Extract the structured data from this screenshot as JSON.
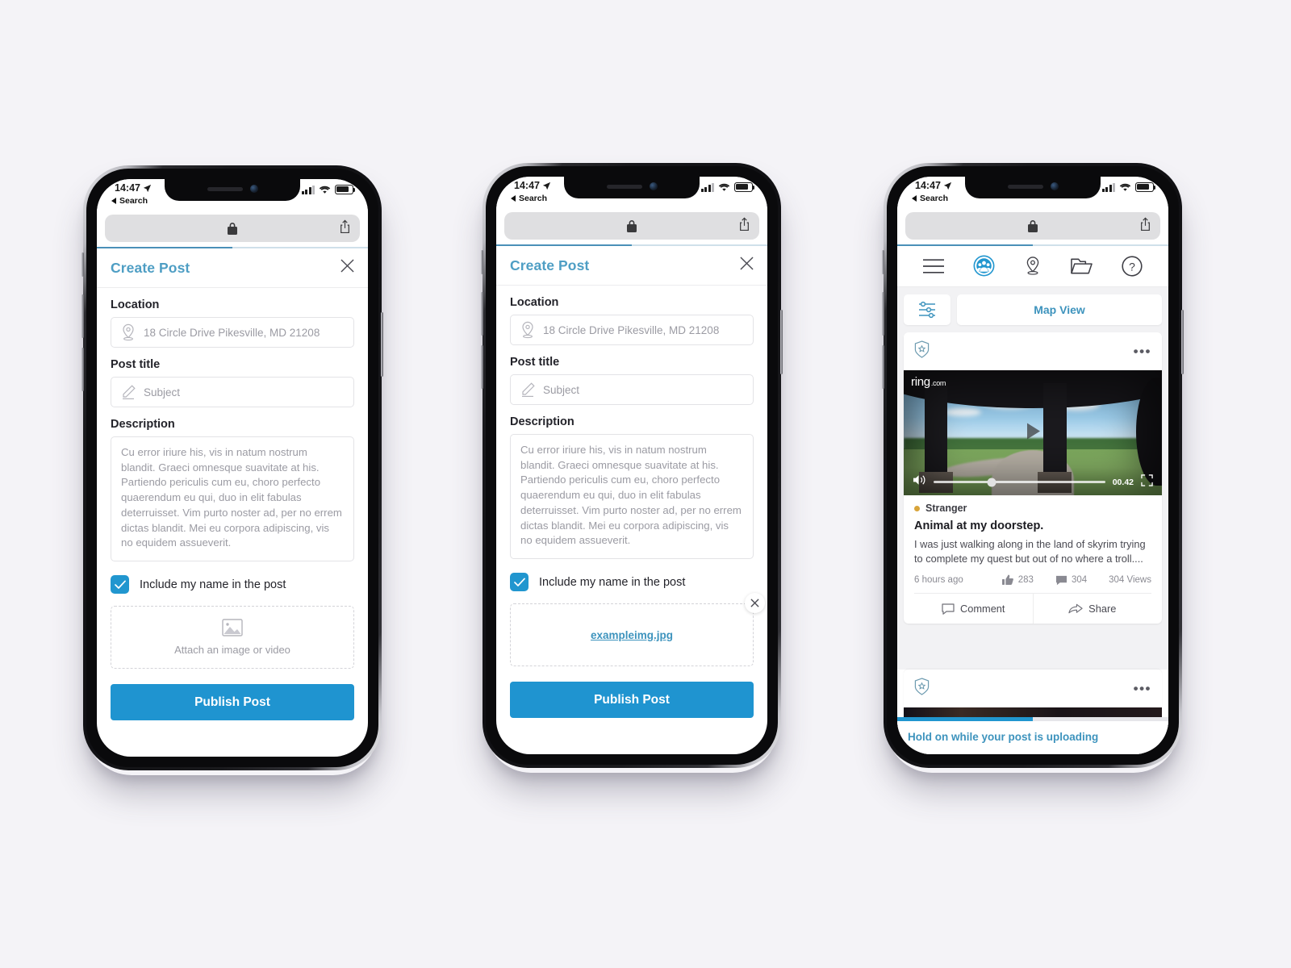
{
  "status_bar": {
    "time": "14:47",
    "back_label": "Search",
    "location_arrow_icon": "location-arrow-icon",
    "signal_icon": "cellular-signal-icon",
    "wifi_icon": "wifi-icon",
    "battery_icon": "battery-icon"
  },
  "browser": {
    "lock_icon": "lock-icon",
    "share_icon": "share-icon",
    "progress_percent": 50
  },
  "create_post": {
    "title": "Create Post",
    "close_icon": "close-icon",
    "location": {
      "label": "Location",
      "icon": "map-pin-icon",
      "value": "18 Circle Drive Pikesville, MD 21208"
    },
    "post_title": {
      "label": "Post title",
      "icon": "pencil-icon",
      "placeholder": "Subject"
    },
    "description": {
      "label": "Description",
      "value": "Cu error iriure his, vis in natum nostrum blandit. Graeci omnesque suavitate at his. Partiendo periculis cum eu, choro perfecto quaerendum eu qui, duo in elit fabulas deterruisset. Vim purto noster ad, per no errem dictas blandit. Mei eu corpora adipiscing, vis no equidem assueverit."
    },
    "include_name": {
      "label": "Include my name in the post",
      "checked": true,
      "check_icon": "checkmark-icon"
    },
    "attachment_empty": {
      "icon": "image-placeholder-icon",
      "label": "Attach an image or video"
    },
    "attachment_filled": {
      "file_name": "exampleimg.jpg",
      "remove_icon": "close-icon"
    },
    "publish_label": "Publish Post"
  },
  "feed": {
    "nav": [
      {
        "name": "menu",
        "icon": "hamburger-menu-icon",
        "active": false
      },
      {
        "name": "community",
        "icon": "community-people-icon",
        "active": true
      },
      {
        "name": "location",
        "icon": "map-pin-icon",
        "active": false
      },
      {
        "name": "files",
        "icon": "folder-icon",
        "active": false
      },
      {
        "name": "help",
        "icon": "question-circle-icon",
        "active": false
      }
    ],
    "filter_icon": "filter-sliders-icon",
    "map_view_label": "Map View",
    "post": {
      "badge_icon": "police-shield-badge-icon",
      "more_icon": "more-options-icon",
      "video": {
        "watermark": "ring",
        "watermark_suffix": ".com",
        "play_icon": "play-icon",
        "volume_icon": "volume-icon",
        "duration": "00.42",
        "fullscreen_icon": "fullscreen-icon",
        "scrub_percent": 34
      },
      "author": "Stranger",
      "title": "Animal at my doorstep.",
      "text": "I was just walking along in the land of skyrim trying to complete my quest but out of no where a troll....",
      "timestamp": "6 hours ago",
      "likes": "283",
      "comments_count": "304",
      "views": "304 Views",
      "like_icon": "thumbs-up-icon",
      "comment_count_icon": "comment-bubble-icon",
      "comment_label": "Comment",
      "comment_icon": "comment-bubble-icon",
      "share_label": "Share",
      "share_icon": "share-arrow-icon"
    },
    "uploading": {
      "badge_icon": "police-shield-badge-icon",
      "more_icon": "more-options-icon",
      "message": "Hold on while your post is uploading",
      "progress_percent": 50
    }
  },
  "colors": {
    "accent_blue": "#1f94d0",
    "link_blue": "#3d93bd",
    "page_bg": "#f4f3f7",
    "badge_yellow": "#d8a43a"
  }
}
